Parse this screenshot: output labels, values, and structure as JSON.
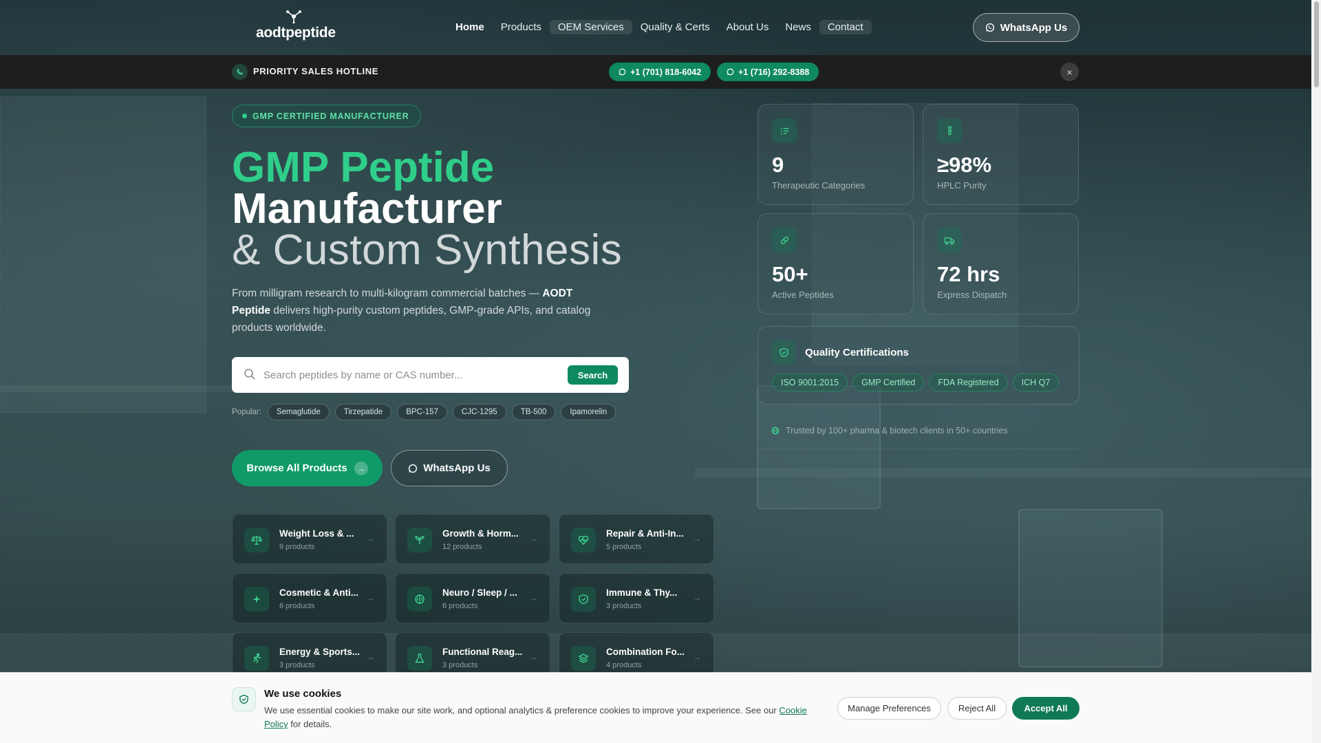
{
  "nav": {
    "logo_text": "aodtpeptide",
    "menu": [
      {
        "label": "Home"
      },
      {
        "label": "Products"
      },
      {
        "label": "OEM Services"
      },
      {
        "label": "Quality & Certs"
      },
      {
        "label": "About Us"
      },
      {
        "label": "News"
      },
      {
        "label": "Contact"
      }
    ],
    "whatsapp_label": "WhatsApp Us"
  },
  "hotline": {
    "label": "PRIORITY SALES HOTLINE",
    "numbers": [
      "+1 (701) 818-6042",
      "+1 (716) 292-8388"
    ],
    "close_symbol": "×"
  },
  "hero": {
    "badge": "GMP CERTIFIED MANUFACTURER",
    "title_line1": "GMP Peptide",
    "title_line2": "Manufacturer",
    "title_line3": "& Custom Synthesis",
    "lead_pre": "From milligram research to multi-kilogram commercial batches — ",
    "lead_brand": "AODT Peptide",
    "lead_post": " delivers high-purity custom peptides, GMP-grade APIs, and catalog products worldwide.",
    "search": {
      "placeholder": "Search peptides by name or CAS number...",
      "button": "Search"
    },
    "popular_label": "Popular:",
    "popular_tags": [
      "Semaglutide",
      "Tirzepatide",
      "BPC-157",
      "CJC-1295",
      "TB-500",
      "Ipamorelin"
    ],
    "browse_label": "Browse All Products",
    "whatsapp_label": "WhatsApp Us"
  },
  "categories": [
    {
      "name": "Weight Loss & ...",
      "count": "9 products",
      "icon": "scale-icon"
    },
    {
      "name": "Growth & Horm...",
      "count": "12 products",
      "icon": "sprout-icon"
    },
    {
      "name": "Repair & Anti-In...",
      "count": "5 products",
      "icon": "heart-pulse-icon"
    },
    {
      "name": "Cosmetic & Anti...",
      "count": "6 products",
      "icon": "sparkles-icon"
    },
    {
      "name": "Neuro / Sleep / ...",
      "count": "6 products",
      "icon": "brain-icon"
    },
    {
      "name": "Immune & Thy...",
      "count": "3 products",
      "icon": "shield-icon"
    },
    {
      "name": "Energy & Sports...",
      "count": "3 products",
      "icon": "running-icon"
    },
    {
      "name": "Functional Reag...",
      "count": "3 products",
      "icon": "flask-icon"
    },
    {
      "name": "Combination Fo...",
      "count": "4 products",
      "icon": "layers-icon"
    }
  ],
  "stats": [
    {
      "value": "9",
      "label": "Therapeutic Categories",
      "icon": "list-icon"
    },
    {
      "value": "≥98%",
      "label": "HPLC Purity",
      "icon": "test-tube-icon"
    },
    {
      "value": "50+",
      "label": "Active Peptides",
      "icon": "pill-icon"
    },
    {
      "value": "72 hrs",
      "label": "Express Dispatch",
      "icon": "truck-icon"
    }
  ],
  "quality": {
    "title": "Quality Certifications",
    "certs": [
      "ISO 9001:2015",
      "GMP Certified",
      "FDA Registered",
      "ICH Q7"
    ]
  },
  "trusted": "Trusted by 100+ pharma & biotech clients in 50+ countries",
  "cookie": {
    "title": "We use cookies",
    "text_pre": "We use essential cookies to make our site work, and optional analytics & preference cookies to improve your experience. See our ",
    "link": "Cookie Policy",
    "text_post": " for details.",
    "manage": "Manage Preferences",
    "reject": "Reject All",
    "accept": "Accept All"
  },
  "colors": {
    "accent": "#0f8a5f",
    "heading_green": "#2fce8a",
    "hotline_bar": "#1d1f1e"
  }
}
